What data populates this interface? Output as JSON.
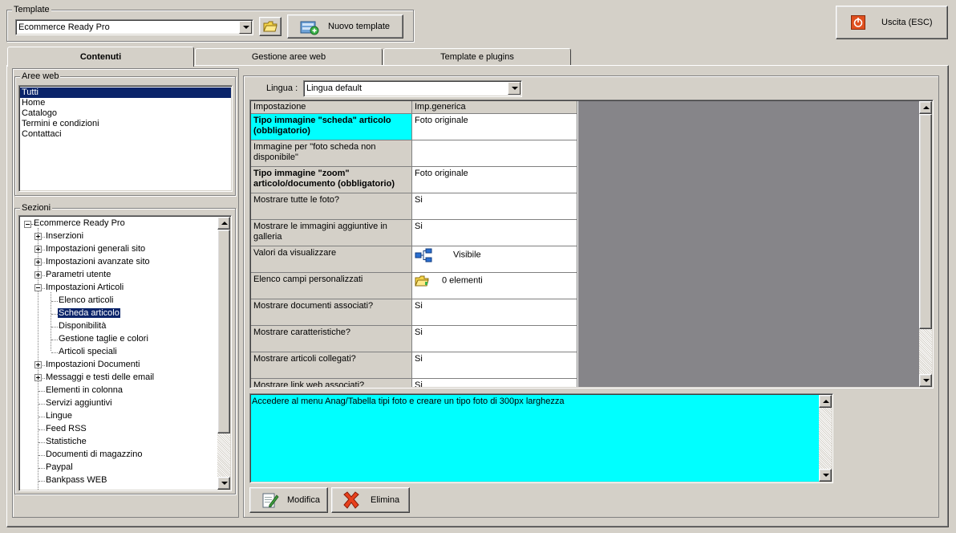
{
  "template_group": {
    "label": "Template",
    "selected": "Ecommerce Ready Pro",
    "new_template_label": "Nuovo template"
  },
  "exit_button": {
    "label": "Uscita (ESC)"
  },
  "tabs": [
    {
      "label": "Contenuti",
      "active": true
    },
    {
      "label": "Gestione aree web",
      "active": false
    },
    {
      "label": "Template e plugins",
      "active": false
    }
  ],
  "areas": {
    "label": "Aree web",
    "items": [
      "Tutti",
      "Home",
      "Catalogo",
      "Termini e condizioni",
      "Contattaci"
    ],
    "selected_index": 0
  },
  "sections": {
    "label": "Sezioni",
    "root": "Ecommerce Ready Pro",
    "nodes": [
      {
        "label": "Inserzioni",
        "level": 1,
        "expander": "plus"
      },
      {
        "label": "Impostazioni generali sito",
        "level": 1,
        "expander": "plus"
      },
      {
        "label": "Impostazioni avanzate sito",
        "level": 1,
        "expander": "plus"
      },
      {
        "label": "Parametri utente",
        "level": 1,
        "expander": "plus"
      },
      {
        "label": "Impostazioni Articoli",
        "level": 1,
        "expander": "minus"
      },
      {
        "label": "Elenco articoli",
        "level": 2,
        "expander": ""
      },
      {
        "label": "Scheda articolo",
        "level": 2,
        "expander": "",
        "selected": true
      },
      {
        "label": "Disponibilità",
        "level": 2,
        "expander": ""
      },
      {
        "label": "Gestione taglie e colori",
        "level": 2,
        "expander": ""
      },
      {
        "label": "Articoli speciali",
        "level": 2,
        "expander": ""
      },
      {
        "label": "Impostazioni Documenti",
        "level": 1,
        "expander": "plus"
      },
      {
        "label": "Messaggi e testi delle email",
        "level": 1,
        "expander": "plus"
      },
      {
        "label": "Elementi in colonna",
        "level": 1,
        "expander": ""
      },
      {
        "label": "Servizi aggiuntivi",
        "level": 1,
        "expander": ""
      },
      {
        "label": "Lingue",
        "level": 1,
        "expander": ""
      },
      {
        "label": "Feed RSS",
        "level": 1,
        "expander": ""
      },
      {
        "label": "Statistiche",
        "level": 1,
        "expander": ""
      },
      {
        "label": "Documenti di magazzino",
        "level": 1,
        "expander": ""
      },
      {
        "label": "Paypal",
        "level": 1,
        "expander": ""
      },
      {
        "label": "Bankpass WEB",
        "level": 1,
        "expander": ""
      }
    ]
  },
  "language": {
    "label": "Lingua :",
    "selected": "Lingua default"
  },
  "settings_grid": {
    "columns": [
      "Impostazione",
      "Imp.generica"
    ],
    "rows": [
      {
        "setting": "Tipo immagine \"scheda\" articolo (obbligatorio)",
        "value": "Foto originale",
        "required": true,
        "active": true
      },
      {
        "setting": "Immagine per \"foto scheda non disponibile\"",
        "value": "",
        "required": false
      },
      {
        "setting": "Tipo immagine \"zoom\" articolo/documento (obbligatorio)",
        "value": "Foto originale",
        "required": true
      },
      {
        "setting": "Mostrare tutte le foto?",
        "value": "Si",
        "required": false
      },
      {
        "setting": "Mostrare le immagini aggiuntive in galleria",
        "value": "Si",
        "required": false
      },
      {
        "setting": "Valori da visualizzare",
        "value": "Visibile",
        "icon": "hierarchy-icon",
        "required": false
      },
      {
        "setting": "Elenco campi personalizzati",
        "value": "0 elementi",
        "icon": "folder-icon",
        "required": false
      },
      {
        "setting": "Mostrare documenti associati?",
        "value": "Si",
        "required": false
      },
      {
        "setting": "Mostrare caratteristiche?",
        "value": "Si",
        "required": false
      },
      {
        "setting": "Mostrare articoli collegati?",
        "value": "Si",
        "required": false
      },
      {
        "setting": "Mostrare link web associati?",
        "value": "Si",
        "required": false
      }
    ]
  },
  "description": {
    "text": "Accedere al menu Anag/Tabella tipi foto e creare un tipo foto di 300px larghezza"
  },
  "actions": {
    "edit_label": "Modifica",
    "delete_label": "Elimina"
  },
  "colors": {
    "selection": "#0a246a",
    "active_row": "#00ffff",
    "panel_gray": "#868589"
  }
}
